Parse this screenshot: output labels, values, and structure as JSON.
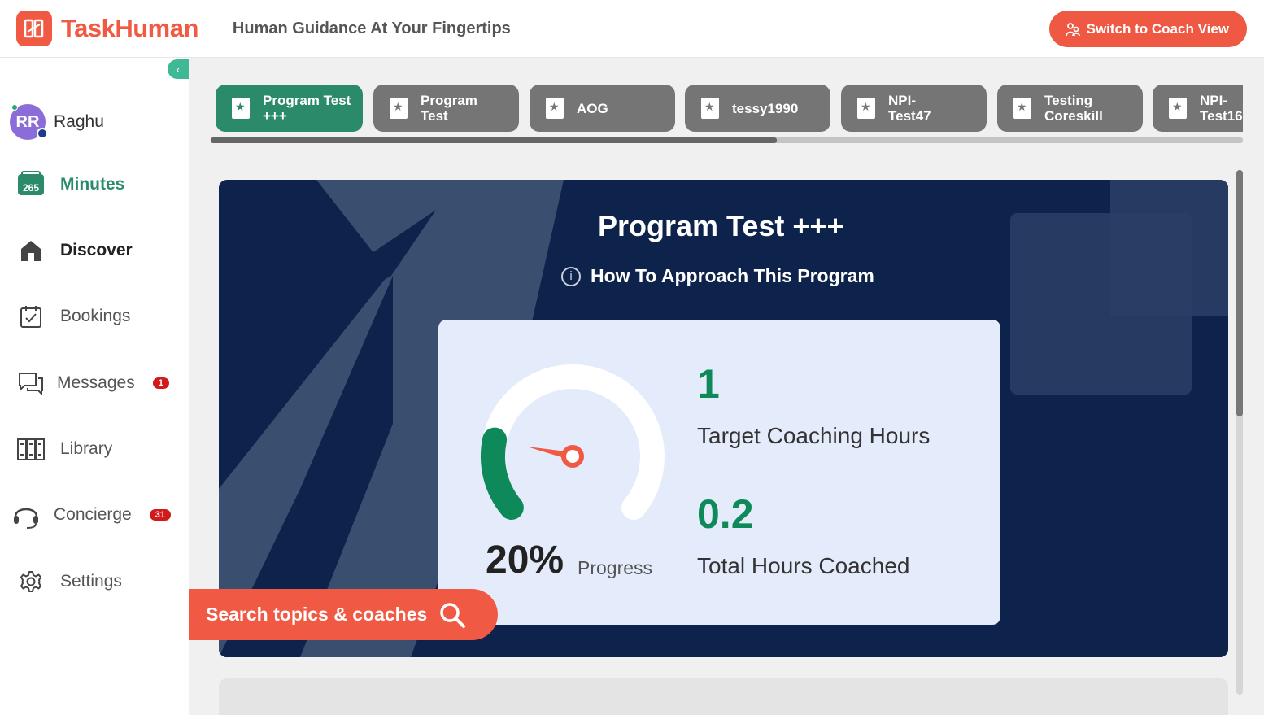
{
  "header": {
    "logo_text": "TaskHuman",
    "tagline": "Human Guidance At Your Fingertips",
    "coach_view_button": "Switch to Coach View"
  },
  "sidebar": {
    "user": {
      "initials": "RR",
      "name": "Raghu"
    },
    "items": [
      {
        "id": "minutes",
        "label": "Minutes",
        "icon": "calendar-minutes-icon",
        "icon_text": "265"
      },
      {
        "id": "discover",
        "label": "Discover",
        "icon": "home-icon"
      },
      {
        "id": "bookings",
        "label": "Bookings",
        "icon": "calendar-check-icon"
      },
      {
        "id": "messages",
        "label": "Messages",
        "icon": "chat-icon",
        "badge": "1"
      },
      {
        "id": "library",
        "label": "Library",
        "icon": "library-icon"
      },
      {
        "id": "concierge",
        "label": "Concierge",
        "icon": "headset-icon",
        "badge": "31"
      },
      {
        "id": "settings",
        "label": "Settings",
        "icon": "gear-icon"
      }
    ]
  },
  "program_tabs": [
    {
      "label": "Program Test\n+++",
      "active": true
    },
    {
      "label": "Program\nTest",
      "active": false
    },
    {
      "label": "AOG",
      "active": false
    },
    {
      "label": "tessy1990",
      "active": false
    },
    {
      "label": "NPI-\nTest47",
      "active": false
    },
    {
      "label": "Testing\nCoreskill",
      "active": false
    },
    {
      "label": "NPI-\nTest16",
      "active": false
    }
  ],
  "hero": {
    "title": "Program Test +++",
    "approach_link": "How To Approach This Program",
    "progress_value": "20%",
    "progress_fraction": 0.2,
    "progress_label": "Progress",
    "target_hours": "1",
    "target_label": "Target Coaching Hours",
    "coached_hours": "0.2",
    "coached_label": "Total Hours Coached"
  },
  "search": {
    "label": "Search topics & coaches"
  },
  "colors": {
    "brand": "#f15a42",
    "accent_green": "#2a8a6a",
    "hero_bg": "#0d234b",
    "badge_red": "#d11b1b"
  }
}
